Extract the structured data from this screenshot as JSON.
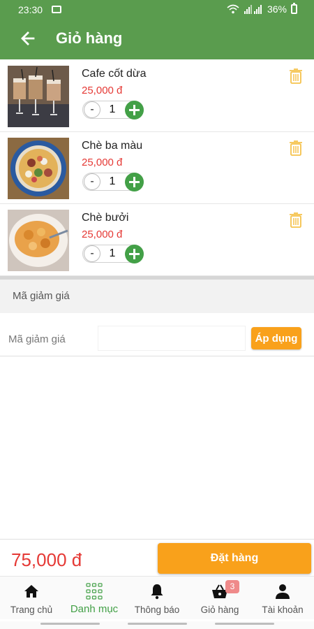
{
  "status_bar": {
    "time": "23:30",
    "battery": "36%"
  },
  "header": {
    "title": "Giỏ hàng"
  },
  "cart": {
    "items": [
      {
        "name": "Cafe cốt dừa",
        "price": "25,000 đ",
        "quantity": "1",
        "minus": "-"
      },
      {
        "name": "Chè ba màu",
        "price": "25,000 đ",
        "quantity": "1",
        "minus": "-"
      },
      {
        "name": "Chè bưởi",
        "price": "25,000 đ",
        "quantity": "1",
        "minus": "-"
      }
    ]
  },
  "discount": {
    "section_title": "Mã giảm giá",
    "field_label": "Mã giảm giá",
    "input_value": "",
    "apply_label": "Áp dụng"
  },
  "order": {
    "total": "75,000 đ",
    "button_label": "Đặt hàng"
  },
  "bottom_nav": {
    "items": [
      {
        "label": "Trang chủ",
        "icon": "home-icon"
      },
      {
        "label": "Danh mục",
        "icon": "grid-icon"
      },
      {
        "label": "Thông báo",
        "icon": "bell-icon"
      },
      {
        "label": "Giỏ hàng",
        "icon": "basket-icon",
        "badge": "3"
      },
      {
        "label": "Tài khoản",
        "icon": "person-icon"
      }
    ],
    "active_index": 1
  },
  "colors": {
    "primary": "#5a9c4e",
    "accent": "#f9a11b",
    "price": "#e53935",
    "add": "#43a047"
  }
}
